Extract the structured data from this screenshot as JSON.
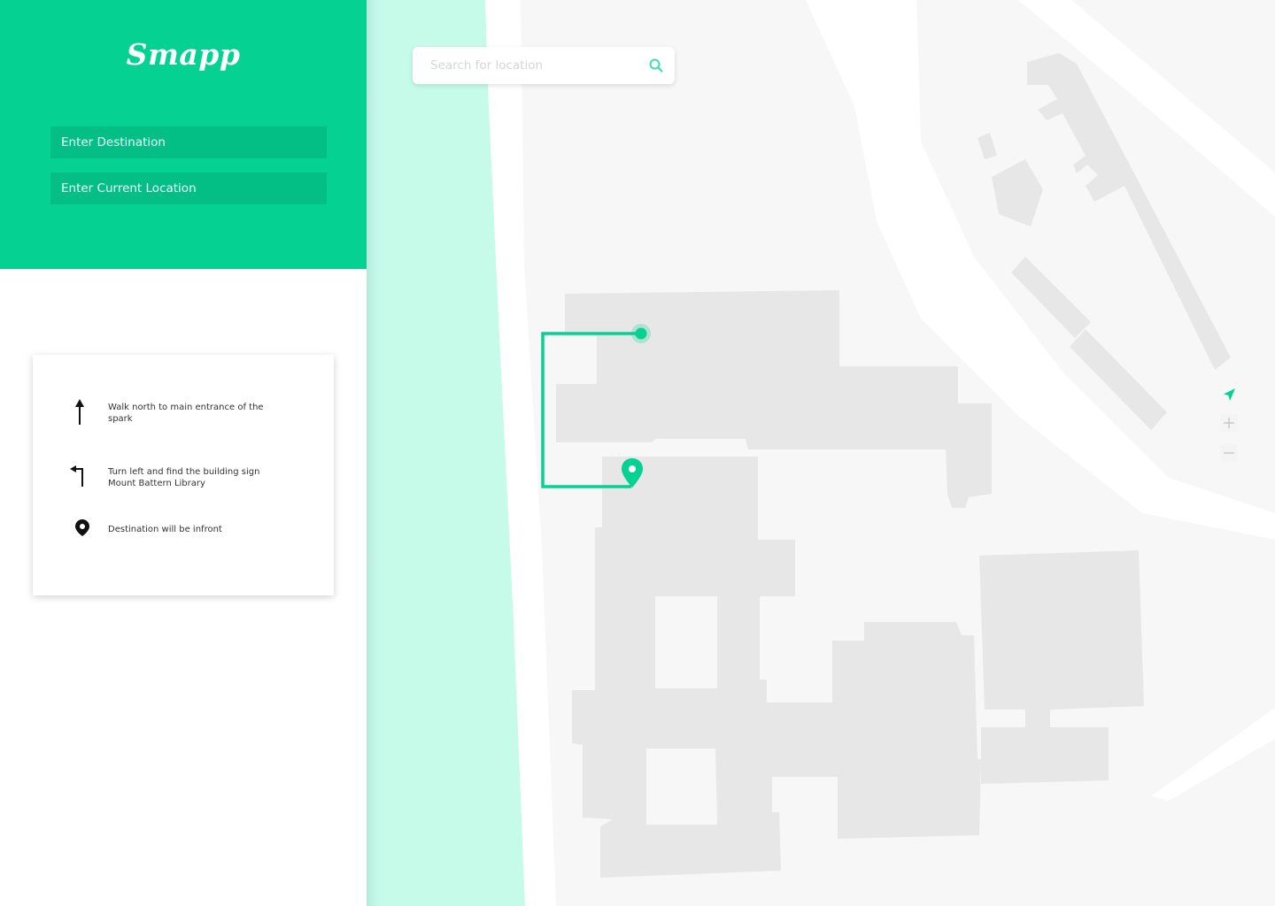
{
  "app": {
    "title": "Smapp"
  },
  "form": {
    "destination_placeholder": "Enter Destination",
    "current_location_placeholder": "Enter Current Location"
  },
  "directions": [
    {
      "icon": "arrow-up-icon",
      "text": "Walk north to main entrance of the spark"
    },
    {
      "icon": "turn-left-icon",
      "text": "Turn left and find the building sign Mount Battern Library"
    },
    {
      "icon": "location-pin-icon",
      "text": "Destination will be infront"
    }
  ],
  "search": {
    "placeholder": "Search for location",
    "icon": "search-icon"
  },
  "map_controls": {
    "locate_icon": "navigation-arrow-icon",
    "zoom_in_icon": "plus-icon",
    "zoom_out_icon": "minus-icon"
  },
  "colors": {
    "brand": "#05d193",
    "field_bg": "#03bf86",
    "water": "#c6fbea",
    "ground": "#f7f7f7",
    "building": "#e7e7e7",
    "route": "#05d193"
  }
}
